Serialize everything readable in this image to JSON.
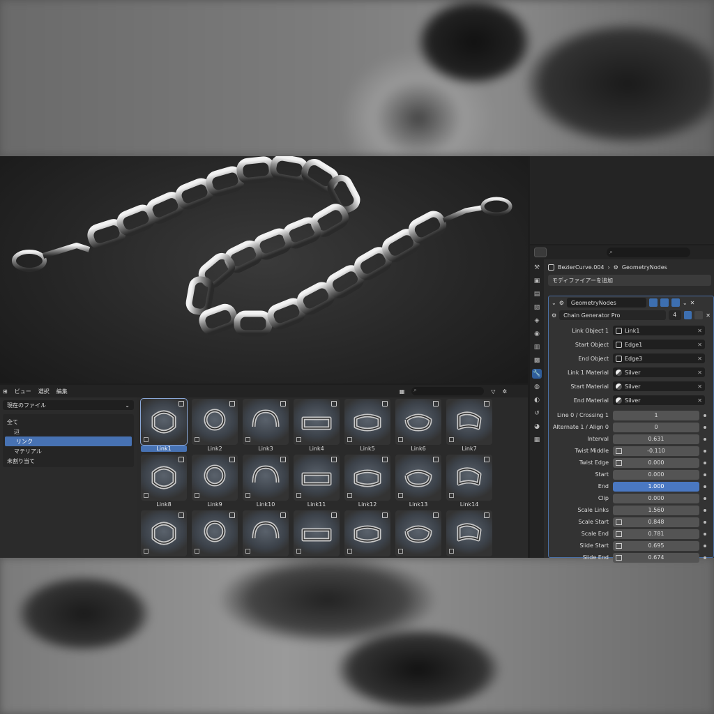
{
  "properties": {
    "search_placeholder": "",
    "breadcrumb": {
      "object": "BezierCurve.004",
      "modifier": "GeometryNodes"
    },
    "add_modifier_label": "モディファイアーを追加",
    "modifier_name": "GeometryNodes",
    "node_group": {
      "name": "Chain Generator Pro",
      "users": "4"
    },
    "object_fields": [
      {
        "label": "Link Object 1",
        "value": "Link1",
        "kind": "object"
      },
      {
        "label": "Start Object",
        "value": "Edge1",
        "kind": "object"
      },
      {
        "label": "End Object",
        "value": "Edge3",
        "kind": "object"
      },
      {
        "label": "Link 1 Material",
        "value": "Silver",
        "kind": "material"
      },
      {
        "label": "Start Material",
        "value": "Silver",
        "kind": "material"
      },
      {
        "label": "End Material",
        "value": "Silver",
        "kind": "material"
      }
    ],
    "number_fields": [
      {
        "label": "Line 0 / Crossing 1",
        "value": "1",
        "icon": false,
        "active": false
      },
      {
        "label": "Alternate 1 / Align 0",
        "value": "0",
        "icon": false,
        "active": false
      },
      {
        "label": "Interval",
        "value": "0.631",
        "icon": false,
        "active": false
      },
      {
        "label": "Twist Middle",
        "value": "-0.110",
        "icon": true,
        "active": false
      },
      {
        "label": "Twist Edge",
        "value": "0.000",
        "icon": true,
        "active": false
      },
      {
        "label": "Start",
        "value": "0.000",
        "icon": false,
        "active": false
      },
      {
        "label": "End",
        "value": "1.000",
        "icon": false,
        "active": true
      },
      {
        "label": "Clip",
        "value": "0.000",
        "icon": false,
        "active": false
      },
      {
        "label": "Scale Links",
        "value": "1.560",
        "icon": false,
        "active": false
      },
      {
        "label": "Scale Start",
        "value": "0.848",
        "icon": true,
        "active": false
      },
      {
        "label": "Scale End",
        "value": "0.781",
        "icon": true,
        "active": false
      },
      {
        "label": "Slide Start",
        "value": "0.695",
        "icon": true,
        "active": false
      },
      {
        "label": "Slide End",
        "value": "0.674",
        "icon": true,
        "active": false
      }
    ]
  },
  "asset_browser": {
    "menu": [
      "ビュー",
      "選択",
      "編集"
    ],
    "library": "現在のファイル",
    "categories": [
      {
        "label": "全て",
        "selected": false
      },
      {
        "label": "辺",
        "selected": false
      },
      {
        "label": "リンク",
        "selected": true
      },
      {
        "label": "マテリアル",
        "selected": false
      },
      {
        "label": "未割り当て",
        "selected": false
      }
    ],
    "assets": [
      {
        "label": "Link1",
        "selected": true
      },
      {
        "label": "Link2",
        "selected": false
      },
      {
        "label": "Link3",
        "selected": false
      },
      {
        "label": "Link4",
        "selected": false
      },
      {
        "label": "Link5",
        "selected": false
      },
      {
        "label": "Link6",
        "selected": false
      },
      {
        "label": "Link7",
        "selected": false
      },
      {
        "label": "Link8",
        "selected": false
      },
      {
        "label": "Link9",
        "selected": false
      },
      {
        "label": "Link10",
        "selected": false
      },
      {
        "label": "Link11",
        "selected": false
      },
      {
        "label": "Link12",
        "selected": false
      },
      {
        "label": "Link13",
        "selected": false
      },
      {
        "label": "Link14",
        "selected": false
      },
      {
        "label": "",
        "selected": false
      },
      {
        "label": "",
        "selected": false
      },
      {
        "label": "",
        "selected": false
      },
      {
        "label": "",
        "selected": false
      },
      {
        "label": "",
        "selected": false
      },
      {
        "label": "",
        "selected": false
      },
      {
        "label": "",
        "selected": false
      }
    ]
  }
}
